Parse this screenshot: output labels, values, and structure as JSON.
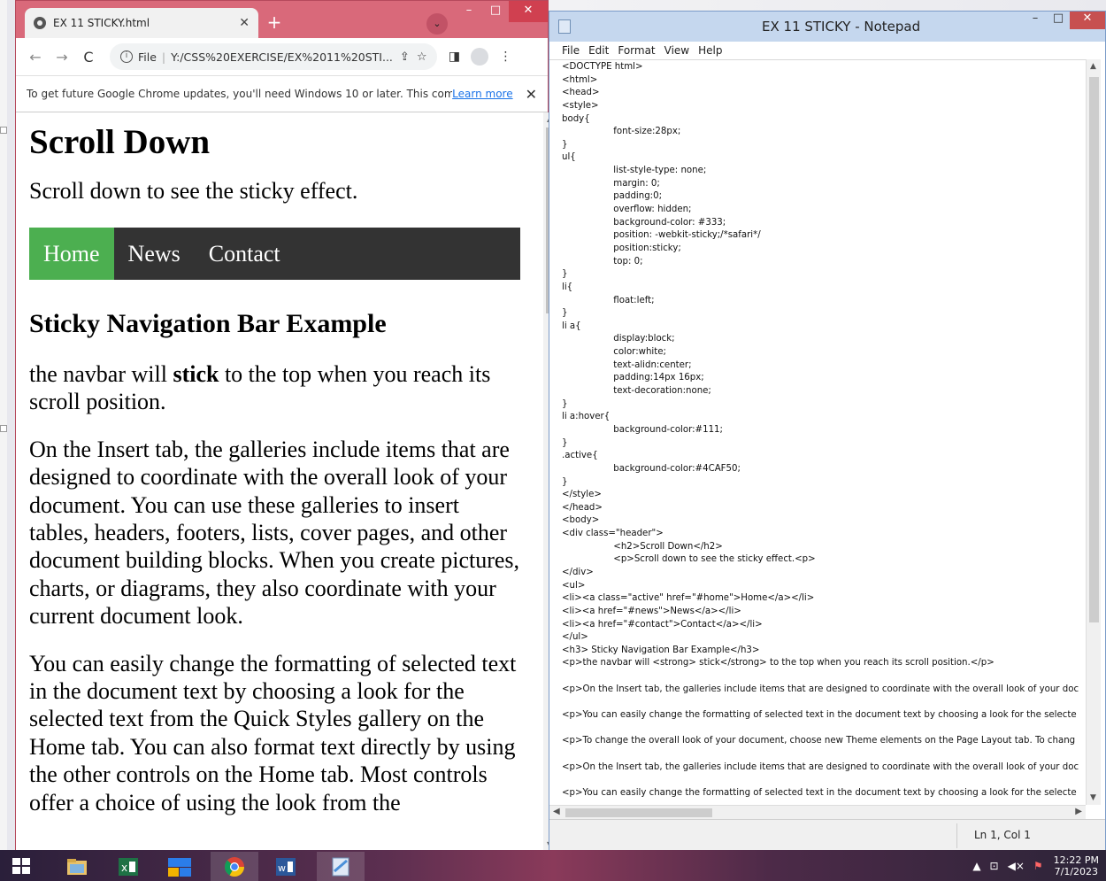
{
  "chrome": {
    "tab_title": "EX 11 STICKY.html",
    "url_label": "File",
    "url": "Y:/CSS%20EXERCISE/EX%2011%20STI...",
    "infobar_message": "To get future Google Chrome updates, you'll need Windows 10 or later. This com...",
    "infobar_link": "Learn more",
    "page": {
      "heading": "Scroll Down",
      "subtext": "Scroll down to see the sticky effect.",
      "nav": [
        "Home",
        "News",
        "Contact"
      ],
      "section_title": "Sticky Navigation Bar Example",
      "p1_before": "the navbar will ",
      "p1_strong": "stick",
      "p1_after": " to the top when you reach its scroll position.",
      "p2": "On the Insert tab, the galleries include items that are designed to coordinate with the overall look of your document. You can use these galleries to insert tables, headers, footers, lists, cover pages, and other document building blocks. When you create pictures, charts, or diagrams, they also coordinate with your current document look.",
      "p3": "You can easily change the formatting of selected text in the document text by choosing a look for the selected text from the Quick Styles gallery on the Home tab. You can also format text directly by using the other controls on the Home tab. Most controls offer a choice of using the look from the"
    }
  },
  "notepad": {
    "title": "EX 11 STICKY - Notepad",
    "menu": [
      "File",
      "Edit",
      "Format",
      "View",
      "Help"
    ],
    "lines": [
      "<DOCTYPE html>",
      "<html>",
      "<head>",
      "<style>",
      "body{",
      "\t\tfont-size:28px;",
      "}",
      "ul{",
      "\t\tlist-style-type: none;",
      "\t\tmargin: 0;",
      "\t\tpadding:0;",
      "\t\toverflow: hidden;",
      "\t\tbackground-color: #333;",
      "\t\tposition: -webkit-sticky;/*safari*/",
      "\t\tposition:sticky;",
      "\t\ttop: 0;",
      "}",
      "li{",
      "\t\tfloat:left;",
      "}",
      "li a{",
      "\t\tdisplay:block;",
      "\t\tcolor:white;",
      "\t\ttext-alidn:center;",
      "\t\tpadding:14px 16px;",
      "\t\ttext-decoration:none;",
      "}",
      "li a:hover{",
      "\t\tbackground-color:#111;",
      "}",
      ".active{",
      "\t\tbackground-color:#4CAF50;",
      "}",
      "</style>",
      "</head>",
      "<body>",
      "<div class=\"header\">",
      "\t\t<h2>Scroll Down</h2>",
      "\t\t<p>Scroll down to see the sticky effect.<p>",
      "</div>",
      "<ul>",
      "<li><a class=\"active\" href=\"#home\">Home</a></li>",
      "<li><a href=\"#news\">News</a></li>",
      "<li><a href=\"#contact\">Contact</a></li>",
      "</ul>",
      "<h3> Sticky Navigation Bar Example</h3>",
      "<p>the navbar will <strong> stick</strong> to the top when you reach its scroll position.</p>",
      "",
      "<p>On the Insert tab, the galleries include items that are designed to coordinate with the overall look of your doc",
      "",
      "<p>You can easily change the formatting of selected text in the document text by choosing a look for the selecte",
      "",
      "<p>To change the overall look of your document, choose new Theme elements on the Page Layout tab. To chang",
      "",
      "<p>On the Insert tab, the galleries include items that are designed to coordinate with the overall look of your doc",
      "",
      "<p>You can easily change the formatting of selected text in the document text by choosing a look for the selecte"
    ],
    "status": "Ln 1, Col 1"
  },
  "taskbar": {
    "time": "12:22 PM",
    "date": "7/1/2023"
  },
  "colors": {
    "chrome_frame": "#d9697a",
    "nav_bg": "#333333",
    "nav_active": "#4CAF50",
    "notepad_title": "#c5d7ee"
  }
}
